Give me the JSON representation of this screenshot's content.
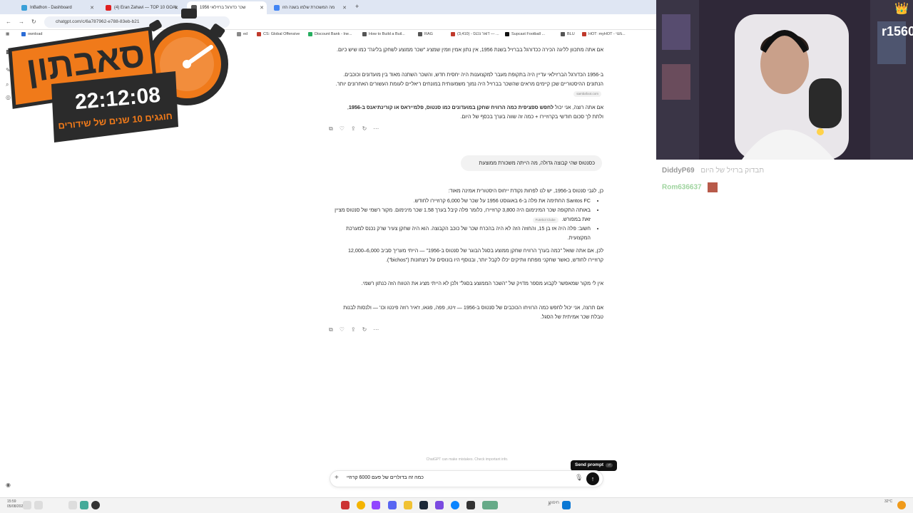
{
  "browser": {
    "tabs": [
      {
        "title": "InBathon - Dashboard",
        "color": "#3aa0d8"
      },
      {
        "title": "(4) Eran Zahavi — TOP 10 GOAL",
        "color": "#e02020"
      },
      {
        "title": "שכר כדורגל ברזילאי 1956",
        "color": "#555555"
      },
      {
        "title": "מה המשכורת שלמו בשנה הזו",
        "color": "#4285f4"
      }
    ],
    "new_tab": "+",
    "url": "chatgpt.com/c/6a787962-e788-83eb-b21",
    "bookmarks": [
      {
        "label": "ownload",
        "color": "#2b6cd6"
      },
      {
        "label": "ed",
        "color": "#888888"
      },
      {
        "label": "CS: Global Offensive",
        "color": "#c0392b"
      },
      {
        "label": "Discount Bank - Ine...",
        "color": "#27ae60"
      },
      {
        "label": "How to Build a Buil...",
        "color": "#555555"
      },
      {
        "label": "RAG",
        "color": "#555555"
      },
      {
        "label": "(3,410) - דואר נכנס — ...",
        "color": "#c0392b"
      },
      {
        "label": "Supcast Football ...",
        "color": "#111111"
      },
      {
        "label": "BLU",
        "color": "#555555"
      },
      {
        "label": "HOT :myHOT - מנוי...",
        "color": "#c0392b"
      }
    ]
  },
  "overlay": {
    "title": "סאבתון",
    "timer": "22:12:08",
    "subtitle": "חוגגים 10 שנים של שידורים",
    "channel": "r1560"
  },
  "chat": {
    "p1": "אם אתה מתכוון לליגה הכירה ככדורגל בברזיל בשנת 1956, אין נתון אמין וזמין שמציג \"שכר ממוצע לשחקן בליגה\" כמו שיש כיום.",
    "p2": "ב-1956 הכדורגל הברזילאי עדיין היה בתקופת מעבר למקצוענות היה יחסית חדש, והשכר השתנה מאוד בין מועדונים וכוכבים. הנתונים ההיסטוריים שכן קיימים מראים שהשכר בברזיל היה נמוך משמעותית במונחים ריאליים לעומת העשורים האחרונים יותר.",
    "p2_source": "sambafoot.com",
    "p3_pre": "אם אתה רוצה, אני יכול ",
    "p3_bold": "לחפש ספציפית כמה הרוויח שחקן במועדונים כמו סנטוס, פלמייראס או קורינתיאנס ב-1956",
    "p3_post": ", ולתת לך סכום חודשי בקרוזיירו + כמה זה שווה בערך בכסף של היום.",
    "user_msg": "כסנטוס שהי קבוצה גדולה, מה הייתה משכורת ממוצעת",
    "a_intro": "כן, לגבי סנטוס ב-1956, יש לנו לפחות נקודת ייחוס היסטורית אמינה מאוד:",
    "b1": "Santos FC החתימה את פלה ב-6 באוגוסט 1956 על שכר של 6,000 קרוזיירו לחודש.",
    "b2": "באותה התקופה שכר המינימום היה 3,800 קרוזיירו, כלומר פלה קיבל בערך 1.58 שכר מינימום. מקור רשמי של סנטוס מציין זאת במפורש.",
    "b2_source": "Futebol Clube",
    "b3": "חשוב: פלה היה אז בן 15, והחוזה הזה לא היה בהכרח שכר של כוכב הקבוצה. הוא היה שחקן צעיר שרק נכנס למערכת המקצועית.",
    "a2": "לכן, אם אתה שואל \"כמה בערך הרוויח שחקן ממוצע בסגל הבוגר של סנטוס ב-1956\" — הייתי מעריך סביב 6,000–12,000 קרוזיירו לחודש, כאשר שחקני מפתח וותיקים יכלו לקבל יותר, ובנוסף היו בונוסים על ניצחונות (\"bichos\").",
    "a3": "אין לי מקור שמאפשר לקבוע מספר מדויק של \"השכר הממוצע בסגל\" ולכן לא הייתי מציג את הטווח הזה כנתון רשמי.",
    "a4": "אם תרצה, אני יכול לחפש כמה הרוויחו הכוכבים של סנטוס ב-1956 — זיטו, פפה, פגאו, ז'איר רוזה פינטו וכו' — ולנסות לבנות טבלת שכר אמיתית של הסגל."
  },
  "composer": {
    "input": "כמה זה בדולרים של פעם 6000 קרוזיי",
    "disclaimer": "ChatGPT can make mistakes. Check important info.",
    "tooltip": "Send prompt",
    "tooltip_key": "⏎"
  },
  "stream_chat": {
    "messages": [
      {
        "user": "DiddyP69",
        "text": "תבדוק ברזיל של היום"
      },
      {
        "user": "Rom636637",
        "text": ""
      }
    ]
  },
  "taskbar": {
    "time": "15:59",
    "date": "05/08/2026",
    "weather": "32°C",
    "search": "חיפוש"
  },
  "colors": {
    "overlay_orange": "#f07a1a",
    "overlay_dark": "#2b2b2b",
    "send": "#111111"
  }
}
